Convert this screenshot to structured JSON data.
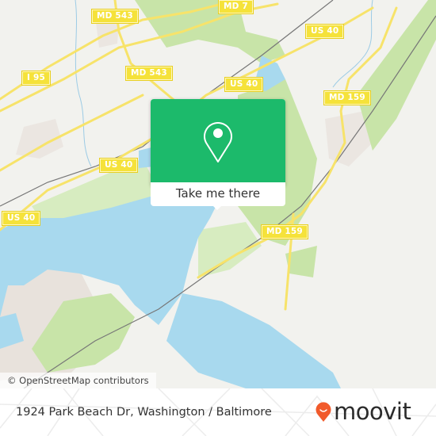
{
  "map": {
    "road_labels": [
      {
        "id": "md7",
        "text": "MD 7"
      },
      {
        "id": "md543-top",
        "text": "MD 543"
      },
      {
        "id": "us40-ne",
        "text": "US 40"
      },
      {
        "id": "i95",
        "text": "I 95"
      },
      {
        "id": "md543-mid",
        "text": "MD 543"
      },
      {
        "id": "us40-center",
        "text": "US 40"
      },
      {
        "id": "md159-north",
        "text": "MD 159"
      },
      {
        "id": "us40-west",
        "text": "US 40"
      },
      {
        "id": "us40-far-west",
        "text": "US 40"
      },
      {
        "id": "md159-south",
        "text": "MD 159"
      }
    ],
    "colors": {
      "land": "#f2f2ee",
      "water": "#a8d9ee",
      "park": "#c8e4a8",
      "road": "#f7e36a",
      "shield": "#f5e23a",
      "railway": "#777777",
      "stream": "#9ccbe5",
      "urban": "#e8e2dc"
    },
    "attribution": "© OpenStreetMap contributors"
  },
  "popup": {
    "icon": "map-pin-icon",
    "button_label": "Take me there",
    "accent_color": "#1cba6b"
  },
  "footer": {
    "address": "1924 Park Beach Dr, Washington / Baltimore",
    "brand": "moovit",
    "brand_color": "#f15a2b"
  }
}
